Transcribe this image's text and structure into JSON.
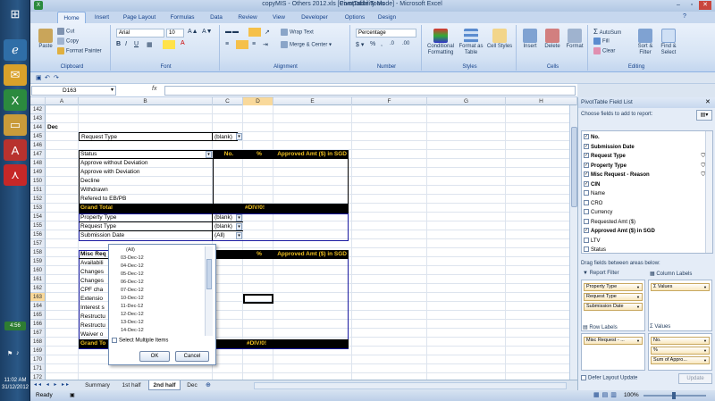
{
  "taskbar": {
    "clock_time": "11:02 AM",
    "clock_date": "31/12/2012",
    "lang": "4:56"
  },
  "window": {
    "title": "copyMIS - Others 2012.xls  [Compatibility Mode] - Microsoft Excel",
    "context_tab": "PivotTable Tools"
  },
  "ribbon": {
    "tabs": [
      "Home",
      "Insert",
      "Page Layout",
      "Formulas",
      "Data",
      "Review",
      "View",
      "Developer",
      "Options",
      "Design"
    ],
    "active_tab": "Home",
    "clipboard": {
      "paste": "Paste",
      "cut": "Cut",
      "copy": "Copy",
      "format_painter": "Format Painter",
      "label": "Clipboard"
    },
    "font": {
      "name": "Arial",
      "size": "10",
      "label": "Font"
    },
    "alignment": {
      "wrap": "Wrap Text",
      "merge": "Merge & Center",
      "label": "Alignment"
    },
    "number": {
      "format": "Percentage",
      "label": "Number"
    },
    "styles": {
      "cond": "Conditional Formatting",
      "table": "Format as Table",
      "cell": "Cell Styles",
      "label": "Styles"
    },
    "cells": {
      "insert": "Insert",
      "delete": "Delete",
      "format": "Format",
      "label": "Cells"
    },
    "editing": {
      "autosum": "AutoSum",
      "fill": "Fill",
      "clear": "Clear",
      "sort": "Sort & Filter",
      "find": "Find & Select",
      "label": "Editing"
    }
  },
  "formula_bar": {
    "name_box": "D163",
    "fx": "fx",
    "value": ""
  },
  "columns": [
    "A",
    "B",
    "C",
    "D",
    "E",
    "F",
    "G",
    "H"
  ],
  "rows": [
    "142",
    "143",
    "144",
    "145",
    "146",
    "147",
    "148",
    "149",
    "150",
    "151",
    "152",
    "153",
    "154",
    "155",
    "156",
    "157",
    "158",
    "159",
    "160",
    "161",
    "162",
    "163",
    "164",
    "165",
    "166",
    "167",
    "168",
    "169",
    "170",
    "171",
    "172"
  ],
  "sheet": {
    "dec_label": "Dec",
    "filter1": {
      "field": "Request Type",
      "value": "(blank)"
    },
    "pivot1": {
      "header_status": "Status",
      "header_no": "No.",
      "header_pct": "%",
      "header_amt": "Approved Amt ($) in SGD",
      "items": [
        "Approve without Deviation",
        "Approve with Deviation",
        "Decline",
        "Withdrawn",
        "Refered to EB/PB"
      ],
      "grand_total": "Grand Total",
      "grand_pct": "#DIV/0!"
    },
    "filter2": [
      {
        "field": "Property Type",
        "value": "(blank)"
      },
      {
        "field": "Request Type",
        "value": "(blank)"
      },
      {
        "field": "Submission Date",
        "value": "(All)"
      }
    ],
    "pivot2": {
      "header": "Misc Req",
      "header_pct": "%",
      "header_amt": "Approved Amt ($) in SGD",
      "items": [
        "Availabili",
        "Changes",
        "Changes",
        "CPF cha",
        "Extensio",
        "Interest s",
        "Restructu",
        "Restructu",
        "Waiver o"
      ],
      "grand_total": "Grand To",
      "grand_pct": "#DIV/0!"
    }
  },
  "filter_popup": {
    "items": [
      "(All)",
      "03-Dec-12",
      "04-Dec-12",
      "05-Dec-12",
      "06-Dec-12",
      "07-Dec-12",
      "10-Dec-12",
      "11-Dec-12",
      "12-Dec-12",
      "13-Dec-12",
      "14-Dec-12"
    ],
    "select_multiple": "Select Multiple Items",
    "ok": "OK",
    "cancel": "Cancel"
  },
  "sheet_tabs": [
    "Summary",
    "1st half",
    "2nd half",
    "Dec"
  ],
  "active_sheet": "2nd half",
  "status": {
    "ready": "Ready",
    "zoom": "100%"
  },
  "pivot_panel": {
    "title": "PivotTable Field List",
    "choose": "Choose fields to add to report:",
    "fields": [
      {
        "name": "No.",
        "checked": true,
        "bold": true,
        "filter": false
      },
      {
        "name": "Submission Date",
        "checked": true,
        "bold": true,
        "filter": false
      },
      {
        "name": "Request Type",
        "checked": true,
        "bold": true,
        "filter": true
      },
      {
        "name": "Property Type",
        "checked": true,
        "bold": true,
        "filter": true
      },
      {
        "name": "Misc Request - Reason",
        "checked": true,
        "bold": true,
        "filter": true
      },
      {
        "name": "CIN",
        "checked": true,
        "bold": true,
        "filter": false
      },
      {
        "name": "Name",
        "checked": false,
        "bold": false,
        "filter": false
      },
      {
        "name": "CRO",
        "checked": false,
        "bold": false,
        "filter": false
      },
      {
        "name": "Currency",
        "checked": false,
        "bold": false,
        "filter": false
      },
      {
        "name": "Requested Amt ($)",
        "checked": false,
        "bold": false,
        "filter": false
      },
      {
        "name": "Approved Amt ($) in SGD",
        "checked": true,
        "bold": true,
        "filter": false
      },
      {
        "name": "LTV",
        "checked": false,
        "bold": false,
        "filter": false
      },
      {
        "name": "Status",
        "checked": false,
        "bold": false,
        "filter": false
      }
    ],
    "drag_label": "Drag fields between areas below:",
    "report_filter_label": "Report Filter",
    "column_labels_label": "Column Labels",
    "row_labels_label": "Row Labels",
    "values_label": "Values",
    "report_filter_items": [
      "Property Type",
      "Request Type",
      "Submission Date"
    ],
    "column_items": [
      "Σ Values"
    ],
    "row_items": [
      "Misc Request - ..."
    ],
    "value_items": [
      "No.",
      "%",
      "Sum of Appro..."
    ],
    "defer": "Defer Layout Update",
    "update": "Update"
  }
}
